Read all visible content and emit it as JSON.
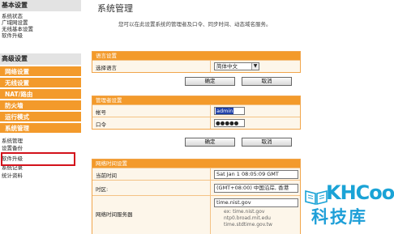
{
  "sidebar": {
    "basic_title": "基本设置",
    "basic_items": [
      "系统状态",
      "广域网设置",
      "无线基本设置",
      "软件升级"
    ],
    "advanced_title": "高级设置",
    "advanced_items": [
      "网络设置",
      "无线设置",
      "NAT/路由",
      "防火墙",
      "运行模式",
      "系统管理"
    ],
    "system_items": [
      "系统管理",
      "设置备份",
      "软件升级",
      "系统记录",
      "统计资料"
    ]
  },
  "main": {
    "title": "系统管理",
    "description": "您可以在此设置系统的管理者及口令、同步时间、动态域名服务。",
    "language_panel": {
      "heading": "语言设置",
      "label": "选择语言",
      "selected": "简体中文",
      "apply": "确定",
      "cancel": "取消"
    },
    "admin_panel": {
      "heading": "管理者设置",
      "account_label": "帐号",
      "account_value": "admin",
      "password_label": "口令",
      "password_value": "●●●●●",
      "apply": "确定",
      "cancel": "取消"
    },
    "ntp_panel": {
      "heading": "网络时间设置",
      "current_time_label": "当前时间",
      "current_time_value": "Sat Jan  1 08:05:09 GMT",
      "timezone_label": "时区:",
      "timezone_value": "(GMT+08:00) 中国沿岸, 香港",
      "server_label": "网络时间服务器",
      "server_value": "time.nist.gov",
      "server_hints": [
        "ex: time.nist.gov",
        "ntp0.broad.mit.edu",
        "time.stdtime.gov.tw"
      ]
    }
  },
  "watermark": {
    "brand": "KHCoo",
    "cn": "科技库"
  },
  "colors": {
    "accent": "#f39a2b",
    "highlight": "#d3121b",
    "watermark": "#1aa3d6"
  }
}
